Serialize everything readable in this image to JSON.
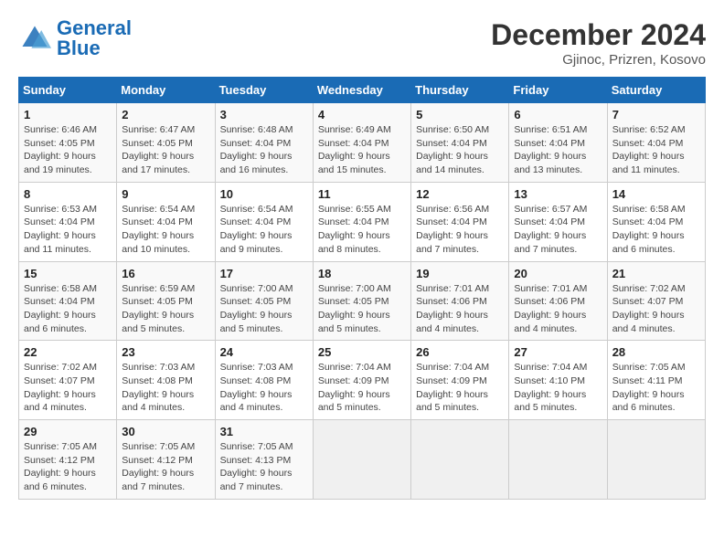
{
  "header": {
    "logo_general": "General",
    "logo_blue": "Blue",
    "title": "December 2024",
    "subtitle": "Gjinoc, Prizren, Kosovo"
  },
  "calendar": {
    "days_of_week": [
      "Sunday",
      "Monday",
      "Tuesday",
      "Wednesday",
      "Thursday",
      "Friday",
      "Saturday"
    ],
    "weeks": [
      [
        {
          "day": "1",
          "sunrise": "6:46 AM",
          "sunset": "4:05 PM",
          "daylight": "9 hours and 19 minutes."
        },
        {
          "day": "2",
          "sunrise": "6:47 AM",
          "sunset": "4:05 PM",
          "daylight": "9 hours and 17 minutes."
        },
        {
          "day": "3",
          "sunrise": "6:48 AM",
          "sunset": "4:04 PM",
          "daylight": "9 hours and 16 minutes."
        },
        {
          "day": "4",
          "sunrise": "6:49 AM",
          "sunset": "4:04 PM",
          "daylight": "9 hours and 15 minutes."
        },
        {
          "day": "5",
          "sunrise": "6:50 AM",
          "sunset": "4:04 PM",
          "daylight": "9 hours and 14 minutes."
        },
        {
          "day": "6",
          "sunrise": "6:51 AM",
          "sunset": "4:04 PM",
          "daylight": "9 hours and 13 minutes."
        },
        {
          "day": "7",
          "sunrise": "6:52 AM",
          "sunset": "4:04 PM",
          "daylight": "9 hours and 11 minutes."
        }
      ],
      [
        {
          "day": "8",
          "sunrise": "6:53 AM",
          "sunset": "4:04 PM",
          "daylight": "9 hours and 11 minutes."
        },
        {
          "day": "9",
          "sunrise": "6:54 AM",
          "sunset": "4:04 PM",
          "daylight": "9 hours and 10 minutes."
        },
        {
          "day": "10",
          "sunrise": "6:54 AM",
          "sunset": "4:04 PM",
          "daylight": "9 hours and 9 minutes."
        },
        {
          "day": "11",
          "sunrise": "6:55 AM",
          "sunset": "4:04 PM",
          "daylight": "9 hours and 8 minutes."
        },
        {
          "day": "12",
          "sunrise": "6:56 AM",
          "sunset": "4:04 PM",
          "daylight": "9 hours and 7 minutes."
        },
        {
          "day": "13",
          "sunrise": "6:57 AM",
          "sunset": "4:04 PM",
          "daylight": "9 hours and 7 minutes."
        },
        {
          "day": "14",
          "sunrise": "6:58 AM",
          "sunset": "4:04 PM",
          "daylight": "9 hours and 6 minutes."
        }
      ],
      [
        {
          "day": "15",
          "sunrise": "6:58 AM",
          "sunset": "4:04 PM",
          "daylight": "9 hours and 6 minutes."
        },
        {
          "day": "16",
          "sunrise": "6:59 AM",
          "sunset": "4:05 PM",
          "daylight": "9 hours and 5 minutes."
        },
        {
          "day": "17",
          "sunrise": "7:00 AM",
          "sunset": "4:05 PM",
          "daylight": "9 hours and 5 minutes."
        },
        {
          "day": "18",
          "sunrise": "7:00 AM",
          "sunset": "4:05 PM",
          "daylight": "9 hours and 5 minutes."
        },
        {
          "day": "19",
          "sunrise": "7:01 AM",
          "sunset": "4:06 PM",
          "daylight": "9 hours and 4 minutes."
        },
        {
          "day": "20",
          "sunrise": "7:01 AM",
          "sunset": "4:06 PM",
          "daylight": "9 hours and 4 minutes."
        },
        {
          "day": "21",
          "sunrise": "7:02 AM",
          "sunset": "4:07 PM",
          "daylight": "9 hours and 4 minutes."
        }
      ],
      [
        {
          "day": "22",
          "sunrise": "7:02 AM",
          "sunset": "4:07 PM",
          "daylight": "9 hours and 4 minutes."
        },
        {
          "day": "23",
          "sunrise": "7:03 AM",
          "sunset": "4:08 PM",
          "daylight": "9 hours and 4 minutes."
        },
        {
          "day": "24",
          "sunrise": "7:03 AM",
          "sunset": "4:08 PM",
          "daylight": "9 hours and 4 minutes."
        },
        {
          "day": "25",
          "sunrise": "7:04 AM",
          "sunset": "4:09 PM",
          "daylight": "9 hours and 5 minutes."
        },
        {
          "day": "26",
          "sunrise": "7:04 AM",
          "sunset": "4:09 PM",
          "daylight": "9 hours and 5 minutes."
        },
        {
          "day": "27",
          "sunrise": "7:04 AM",
          "sunset": "4:10 PM",
          "daylight": "9 hours and 5 minutes."
        },
        {
          "day": "28",
          "sunrise": "7:05 AM",
          "sunset": "4:11 PM",
          "daylight": "9 hours and 6 minutes."
        }
      ],
      [
        {
          "day": "29",
          "sunrise": "7:05 AM",
          "sunset": "4:12 PM",
          "daylight": "9 hours and 6 minutes."
        },
        {
          "day": "30",
          "sunrise": "7:05 AM",
          "sunset": "4:12 PM",
          "daylight": "9 hours and 7 minutes."
        },
        {
          "day": "31",
          "sunrise": "7:05 AM",
          "sunset": "4:13 PM",
          "daylight": "9 hours and 7 minutes."
        },
        null,
        null,
        null,
        null
      ]
    ]
  }
}
